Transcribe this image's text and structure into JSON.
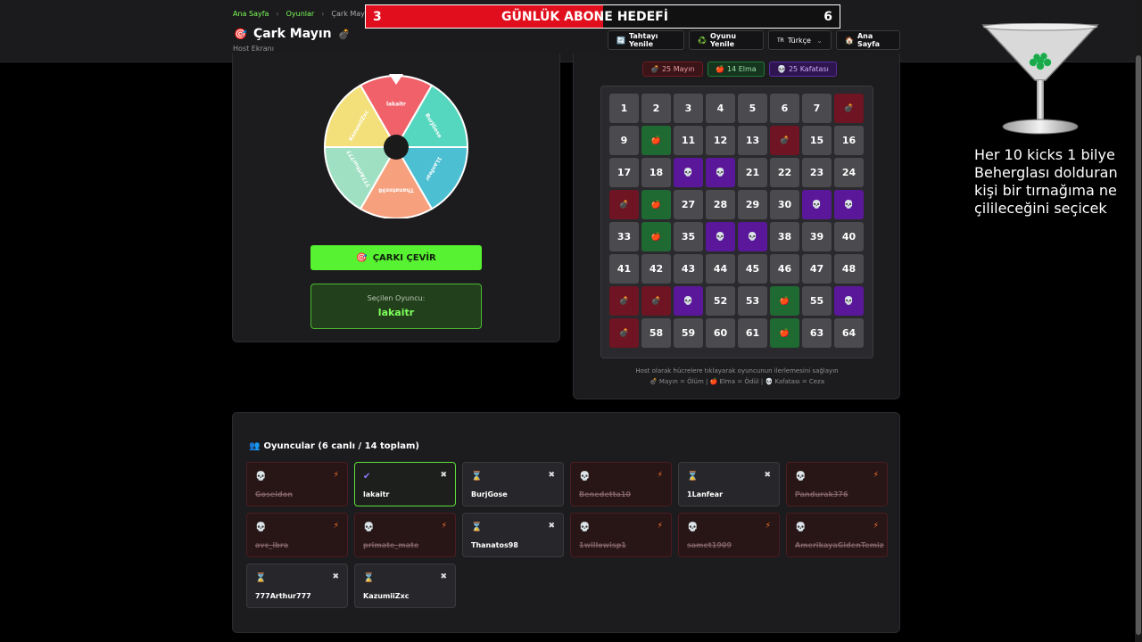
{
  "breadcrumb": {
    "home": "Ana Sayfa",
    "games": "Oyunlar",
    "current": "Çark Mayın"
  },
  "header": {
    "title": "Çark Mayın",
    "subtitle": "Host Ekranı",
    "title_icon": "crosshair-icon",
    "bomb_icon": "bomb-icon"
  },
  "goal": {
    "label": "GÜNLÜK ABONE HEDEFİ",
    "current": "3",
    "target": "6",
    "progress": 0.5,
    "color": "#e10f1d"
  },
  "nav": {
    "refresh_board": {
      "icon": "🔄",
      "label": "Tahtayı Yenile"
    },
    "refresh_game": {
      "icon": "♻️",
      "label": "Oyunu Yenile"
    },
    "language": {
      "icon": "TR",
      "label": "Türkçe"
    },
    "home": {
      "icon": "🏠",
      "label": "Ana Sayfa"
    }
  },
  "wheel": {
    "segments": [
      {
        "name": "lakaitr",
        "color": "#f0616a"
      },
      {
        "name": "BurjGose",
        "color": "#55d6be"
      },
      {
        "name": "1Lanfear",
        "color": "#4cbfd2"
      },
      {
        "name": "Thanatos98",
        "color": "#f7a07e"
      },
      {
        "name": "777Arthur777",
        "color": "#9fe0c2"
      },
      {
        "name": "KazumiiZxc",
        "color": "#f3e07a"
      }
    ]
  },
  "spin_button": {
    "icon": "🎯",
    "label": "ÇARKI ÇEVİR"
  },
  "selected_player": {
    "label": "Seçilen Oyuncu:",
    "name": "lakaitr"
  },
  "counts": {
    "mines": {
      "icon": "💣",
      "label": "25 Mayın"
    },
    "apples": {
      "icon": "🍎",
      "label": "14 Elma"
    },
    "skulls": {
      "icon": "💀",
      "label": "25 Kafatası"
    }
  },
  "board": {
    "icons": {
      "mine": "💣",
      "apple": "🍎",
      "skull": "💀"
    },
    "cells": [
      "1",
      "2",
      "3",
      "4",
      "5",
      "6",
      "7",
      "mine",
      "9",
      "apple",
      "11",
      "12",
      "13",
      "mine",
      "15",
      "16",
      "17",
      "18",
      "skull",
      "skull",
      "21",
      "22",
      "23",
      "24",
      "mine",
      "apple",
      "27",
      "28",
      "29",
      "30",
      "skull",
      "skull",
      "33",
      "apple",
      "35",
      "skull",
      "skull",
      "38",
      "39",
      "40",
      "41",
      "42",
      "43",
      "44",
      "45",
      "46",
      "47",
      "48",
      "mine",
      "mine",
      "skull",
      "52",
      "53",
      "apple",
      "55",
      "skull",
      "mine",
      "58",
      "59",
      "60",
      "61",
      "apple",
      "63",
      "64"
    ]
  },
  "hints": {
    "line1": "Host olarak hücrelere tıklayarak oyuncunun ilerlemesini sağlayın",
    "line2": "💣 Mayın = Ölüm | 🍎 Elma = Ödül | 💀 Kafatası = Ceza"
  },
  "players": {
    "icon": "👥",
    "title": "Oyuncular (6 canlı / 14 toplam)",
    "status_icons": {
      "dead": "💀",
      "selected": "✔",
      "waiting": "⌛"
    },
    "action_icons": {
      "dead": "⚡",
      "alive": "✖"
    },
    "list": [
      {
        "name": "Goseidon",
        "state": "dead"
      },
      {
        "name": "lakaitr",
        "state": "selected"
      },
      {
        "name": "BurjGose",
        "state": "waiting"
      },
      {
        "name": "Benedetta10",
        "state": "dead"
      },
      {
        "name": "1Lanfear",
        "state": "waiting"
      },
      {
        "name": "Pandurak376",
        "state": "dead"
      },
      {
        "name": "avc_ibra",
        "state": "dead"
      },
      {
        "name": "primate_mate",
        "state": "dead"
      },
      {
        "name": "Thanatos98",
        "state": "waiting"
      },
      {
        "name": "1willowisp1",
        "state": "dead"
      },
      {
        "name": "samet1909",
        "state": "dead"
      },
      {
        "name": "AmerikayaGidenTemizli...",
        "state": "dead"
      },
      {
        "name": "777Arthur777",
        "state": "waiting"
      },
      {
        "name": "KazumiiZxc",
        "state": "waiting"
      }
    ]
  },
  "overlay": {
    "glass_icon": "martini-glass-icon",
    "note": "Her 10 kicks 1 bilye Beherglası dolduran kişi bir tırnağıma ne çilileceğini seçicek"
  }
}
